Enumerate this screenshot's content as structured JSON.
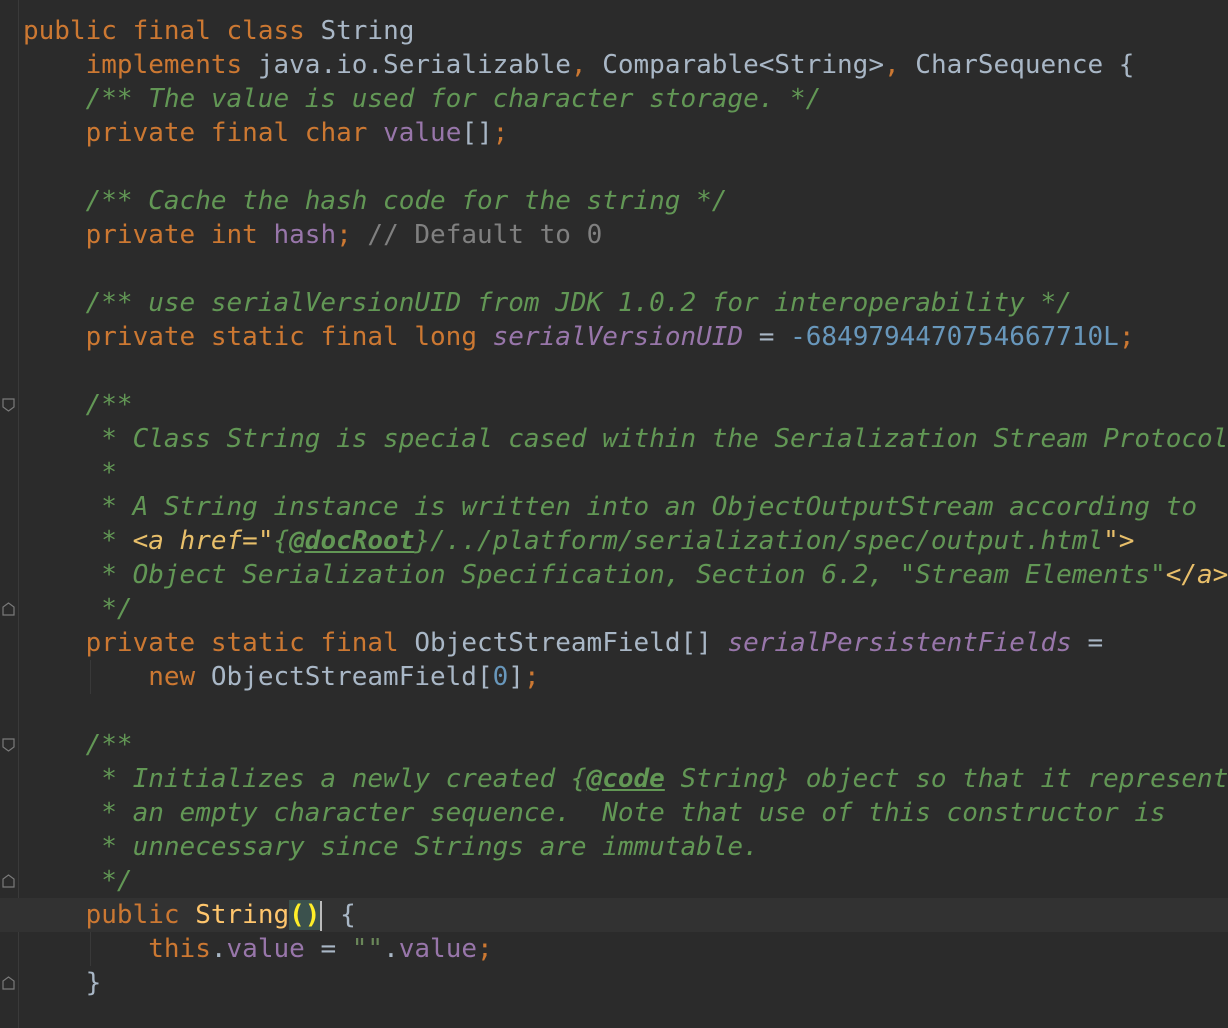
{
  "editor": {
    "language": "java",
    "lines": [
      [
        {
          "t": "public",
          "c": "kw"
        },
        {
          "t": " "
        },
        {
          "t": "final",
          "c": "kw"
        },
        {
          "t": " "
        },
        {
          "t": "class",
          "c": "kw"
        },
        {
          "t": " String"
        }
      ],
      [
        {
          "t": "    "
        },
        {
          "t": "implements",
          "c": "kw"
        },
        {
          "t": " java.io.Serializable"
        },
        {
          "t": ",",
          "c": "kw"
        },
        {
          "t": " Comparable<String>"
        },
        {
          "t": ",",
          "c": "kw"
        },
        {
          "t": " CharSequence {"
        }
      ],
      [
        {
          "t": "    "
        },
        {
          "t": "/** The value is used for character storage. */",
          "c": "doc"
        }
      ],
      [
        {
          "t": "    "
        },
        {
          "t": "private",
          "c": "kw"
        },
        {
          "t": " "
        },
        {
          "t": "final",
          "c": "kw"
        },
        {
          "t": " "
        },
        {
          "t": "char",
          "c": "kw"
        },
        {
          "t": " "
        },
        {
          "t": "value",
          "c": "fld"
        },
        {
          "t": "[]"
        },
        {
          "t": ";",
          "c": "kw"
        }
      ],
      [],
      [
        {
          "t": "    "
        },
        {
          "t": "/** Cache the hash code for the string */",
          "c": "doc"
        }
      ],
      [
        {
          "t": "    "
        },
        {
          "t": "private",
          "c": "kw"
        },
        {
          "t": " "
        },
        {
          "t": "int",
          "c": "kw"
        },
        {
          "t": " "
        },
        {
          "t": "hash",
          "c": "fld"
        },
        {
          "t": ";",
          "c": "kw"
        },
        {
          "t": " "
        },
        {
          "t": "// Default to 0",
          "c": "cmt"
        }
      ],
      [],
      [
        {
          "t": "    "
        },
        {
          "t": "/** use serialVersionUID from JDK 1.0.2 for interoperability */",
          "c": "doc"
        }
      ],
      [
        {
          "t": "    "
        },
        {
          "t": "private",
          "c": "kw"
        },
        {
          "t": " "
        },
        {
          "t": "static",
          "c": "kw"
        },
        {
          "t": " "
        },
        {
          "t": "final",
          "c": "kw"
        },
        {
          "t": " "
        },
        {
          "t": "long",
          "c": "kw"
        },
        {
          "t": " "
        },
        {
          "t": "serialVersionUID",
          "c": "sfld"
        },
        {
          "t": " = "
        },
        {
          "t": "-6849794470754667710L",
          "c": "num"
        },
        {
          "t": ";",
          "c": "kw"
        }
      ],
      [],
      [
        {
          "t": "    "
        },
        {
          "t": "/**",
          "c": "doc"
        }
      ],
      [
        {
          "t": "     "
        },
        {
          "t": "* Class String is special cased within the Serialization Stream Protocol.",
          "c": "doc"
        }
      ],
      [
        {
          "t": "     "
        },
        {
          "t": "*",
          "c": "doc"
        }
      ],
      [
        {
          "t": "     "
        },
        {
          "t": "* A String instance is written into an ObjectOutputStream according to",
          "c": "doc"
        }
      ],
      [
        {
          "t": "     "
        },
        {
          "t": "* ",
          "c": "doc"
        },
        {
          "t": "<a href=\"",
          "c": "htmltag"
        },
        {
          "t": "{",
          "c": "doc"
        },
        {
          "t": "@docRoot",
          "c": "doctag"
        },
        {
          "t": "}/../platform/serialization/spec/output.html",
          "c": "doc"
        },
        {
          "t": "\">",
          "c": "htmltag"
        }
      ],
      [
        {
          "t": "     "
        },
        {
          "t": "* Object Serialization Specification, Section 6.2, \"Stream Elements\"",
          "c": "doc"
        },
        {
          "t": "</a>",
          "c": "htmltag"
        }
      ],
      [
        {
          "t": "     "
        },
        {
          "t": "*/",
          "c": "doc"
        }
      ],
      [
        {
          "t": "    "
        },
        {
          "t": "private",
          "c": "kw"
        },
        {
          "t": " "
        },
        {
          "t": "static",
          "c": "kw"
        },
        {
          "t": " "
        },
        {
          "t": "final",
          "c": "kw"
        },
        {
          "t": " ObjectStreamField[] "
        },
        {
          "t": "serialPersistentFields",
          "c": "sfld"
        },
        {
          "t": " ="
        }
      ],
      [
        {
          "t": "        "
        },
        {
          "t": "new",
          "c": "kw"
        },
        {
          "t": " ObjectStreamField["
        },
        {
          "t": "0",
          "c": "num"
        },
        {
          "t": "]"
        },
        {
          "t": ";",
          "c": "kw"
        }
      ],
      [],
      [
        {
          "t": "    "
        },
        {
          "t": "/**",
          "c": "doc"
        }
      ],
      [
        {
          "t": "     "
        },
        {
          "t": "* Initializes a newly created ",
          "c": "doc"
        },
        {
          "t": "{",
          "c": "doc"
        },
        {
          "t": "@code",
          "c": "doctag"
        },
        {
          "t": " String} object so that it represents",
          "c": "doc"
        }
      ],
      [
        {
          "t": "     "
        },
        {
          "t": "* an empty character sequence.  Note that use of this constructor is",
          "c": "doc"
        }
      ],
      [
        {
          "t": "     "
        },
        {
          "t": "* unnecessary since Strings are immutable.",
          "c": "doc"
        }
      ],
      [
        {
          "t": "     "
        },
        {
          "t": "*/",
          "c": "doc"
        }
      ],
      [
        {
          "t": "    "
        },
        {
          "t": "public",
          "c": "kw"
        },
        {
          "t": " "
        },
        {
          "t": "String",
          "c": "fn"
        },
        {
          "t": "()",
          "c": "paren-match"
        },
        {
          "t": "",
          "c": "caret"
        },
        {
          "t": " {"
        }
      ],
      [
        {
          "t": "        "
        },
        {
          "t": "this",
          "c": "kw"
        },
        {
          "t": "."
        },
        {
          "t": "value",
          "c": "fld"
        },
        {
          "t": " = "
        },
        {
          "t": "\"\"",
          "c": "str"
        },
        {
          "t": "."
        },
        {
          "t": "value",
          "c": "fld"
        },
        {
          "t": ";",
          "c": "kw"
        }
      ],
      [
        {
          "t": "    }"
        }
      ]
    ],
    "current_line": 26,
    "fold_marker_lines": [
      11,
      17,
      21,
      25,
      26,
      28
    ]
  },
  "colors": {
    "background": "#2b2b2b",
    "keyword": "#cc7832",
    "field": "#9876aa",
    "doc_comment": "#629755",
    "line_comment": "#808080",
    "number": "#6897bb",
    "string": "#6a8759",
    "method": "#ffc66d",
    "plain": "#a9b7c6"
  }
}
